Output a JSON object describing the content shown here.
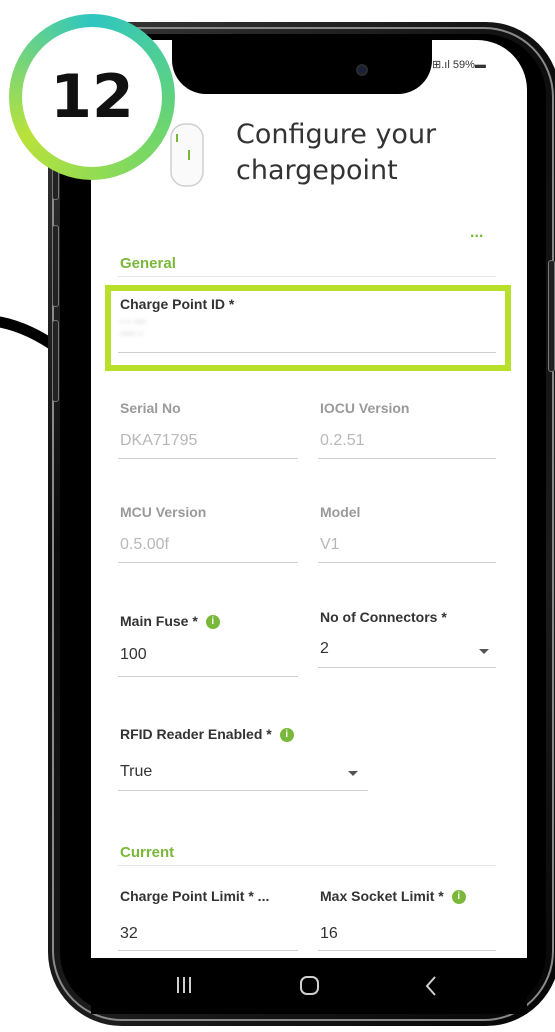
{
  "step_badge": {
    "number": "12"
  },
  "status_bar": {
    "text": "⊞.ıl 59%▬"
  },
  "header": {
    "title_line1": "Configure your",
    "title_line2": "chargepoint",
    "more_label": "..."
  },
  "sections": {
    "general": "General",
    "current": "Current"
  },
  "fields": {
    "charge_point_id": {
      "label": "Charge Point ID *"
    },
    "serial_no": {
      "label": "Serial No",
      "value": "DKA71795"
    },
    "iocu_version": {
      "label": "IOCU Version",
      "value": "0.2.51"
    },
    "mcu_version": {
      "label": "MCU Version",
      "value": "0.5.00f"
    },
    "model": {
      "label": "Model",
      "value": "V1"
    },
    "main_fuse": {
      "label": "Main Fuse *",
      "value": "100"
    },
    "no_of_connectors": {
      "label": "No of Connectors *",
      "value": "2"
    },
    "rfid_reader": {
      "label": "RFID Reader Enabled *",
      "value": "True"
    },
    "charge_point_limit": {
      "label": "Charge Point Limit * ...",
      "value": "32"
    },
    "max_socket_limit": {
      "label": "Max Socket Limit *",
      "value": "16"
    }
  },
  "icons": {
    "info": "info-icon",
    "dropdown": "chevron-down-icon",
    "back": "back-icon",
    "home": "home-icon",
    "recents": "recents-icon"
  },
  "colors": {
    "accent": "#7ab83a",
    "highlight": "#b8e02a"
  }
}
